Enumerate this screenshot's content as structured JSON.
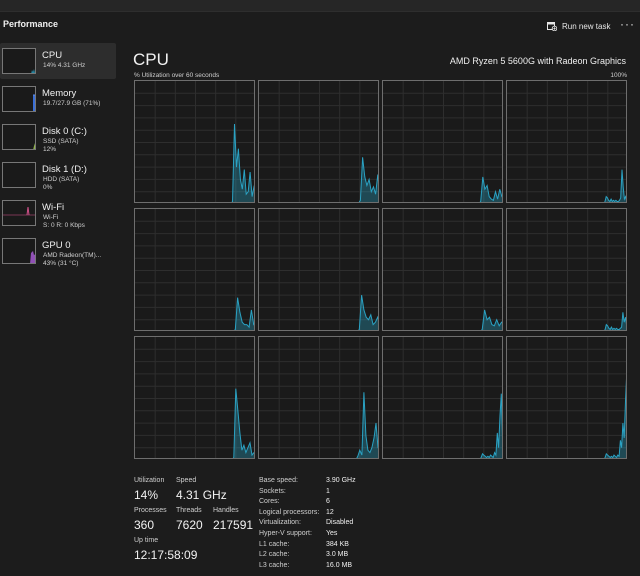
{
  "app": {
    "title": "Performance"
  },
  "toolbar": {
    "run_new_task": "Run new task",
    "more": "···"
  },
  "sidebar": {
    "items": [
      {
        "name": "CPU",
        "lines": [
          "14% 4.31 GHz"
        ],
        "color": "#2aa2c3",
        "level": 0.14
      },
      {
        "name": "Memory",
        "lines": [
          "19.7/27.9 GB (71%)"
        ],
        "color": "#3a6fd8",
        "level": 0.71
      },
      {
        "name": "Disk 0 (C:)",
        "lines": [
          "SSD (SATA)",
          "12%"
        ],
        "color": "#8fb34a",
        "level": 0.12
      },
      {
        "name": "Disk 1 (D:)",
        "lines": [
          "HDD (SATA)",
          "0%"
        ],
        "color": "#8fb34a",
        "level": 0.0
      },
      {
        "name": "Wi-Fi",
        "lines": [
          "Wi-Fi",
          "S: 0 R: 0 Kbps"
        ],
        "color": "#d0508a",
        "level": 0.0
      },
      {
        "name": "GPU 0",
        "lines": [
          "AMD Radeon(TM)...",
          "43% (31 °C)"
        ],
        "color": "#a65bd1",
        "level": 0.43
      }
    ]
  },
  "main": {
    "title": "CPU",
    "model": "AMD Ryzen 5 5600G with Radeon Graphics",
    "util_label": "% Utilization over 60 seconds",
    "util_max": "100%"
  },
  "chart_data": {
    "type": "area",
    "title": "% Utilization over 60 seconds",
    "ylim": [
      0,
      100
    ],
    "grid": true,
    "color": "#2aa2c3",
    "series": [
      {
        "values": [
          0,
          0,
          0,
          0,
          0,
          0,
          0,
          0,
          0,
          0,
          0,
          0,
          0,
          0,
          0,
          0,
          0,
          0,
          0,
          0,
          0,
          0,
          0,
          0,
          0,
          0,
          0,
          0,
          0,
          0,
          0,
          0,
          0,
          0,
          0,
          0,
          0,
          0,
          0,
          0,
          0,
          0,
          0,
          0,
          0,
          0,
          0,
          0,
          0,
          0,
          0,
          0,
          0,
          0,
          0,
          0,
          0,
          0,
          0,
          0,
          0,
          0,
          0,
          0,
          0,
          0,
          0,
          0,
          0,
          0,
          0,
          0,
          0,
          0,
          0,
          0,
          0,
          0,
          0,
          0,
          0,
          0,
          0,
          0,
          0,
          0,
          0,
          0,
          0,
          0,
          0,
          0,
          0,
          0,
          0,
          0,
          0,
          0,
          0,
          0,
          0,
          0,
          0,
          0,
          0,
          0,
          0,
          0,
          0,
          0,
          0,
          0,
          0,
          0,
          0,
          0,
          0,
          0,
          0,
          0
        ]
      },
      {
        "values": [
          0
        ]
      }
    ],
    "cores": [
      [
        0,
        0,
        0,
        0,
        0,
        0,
        0,
        0,
        0,
        0,
        0,
        0,
        0,
        0,
        0,
        0,
        0,
        0,
        0,
        0,
        0,
        0,
        0,
        0,
        0,
        0,
        0,
        0,
        0,
        0,
        0,
        0,
        0,
        0,
        0,
        0,
        0,
        0,
        0,
        0,
        0,
        0,
        0,
        0,
        0,
        0,
        0,
        0,
        0,
        0,
        0,
        0,
        0,
        0,
        0,
        0,
        0,
        0,
        0,
        0,
        0,
        0,
        0,
        0,
        0,
        0,
        0,
        0,
        0,
        0,
        0,
        0,
        0,
        0,
        0,
        0,
        0,
        0,
        0,
        0,
        0,
        0,
        0,
        0,
        0,
        0,
        0,
        0,
        0,
        0,
        0,
        0,
        0,
        0,
        0,
        0,
        0,
        0,
        0,
        0,
        0,
        0,
        0,
        0,
        0,
        0,
        0,
        0,
        0,
        0,
        0,
        0,
        0,
        0,
        0,
        0,
        0,
        0,
        0,
        0,
        0
      ]
    ]
  },
  "cores_chart": [
    [
      0,
      0,
      0,
      0,
      0,
      0,
      0,
      0,
      0,
      0,
      0,
      0,
      0,
      0,
      0,
      0,
      0,
      0,
      0,
      0,
      0,
      0,
      0,
      0,
      0,
      0,
      0,
      0,
      0,
      0,
      0,
      0,
      0,
      0,
      0,
      0,
      0,
      0,
      0,
      0,
      0,
      0,
      0,
      0,
      0,
      0,
      0,
      0,
      0,
      0,
      0,
      0,
      0,
      0,
      0,
      0,
      0,
      0,
      0,
      0,
      0,
      0,
      0,
      0,
      0,
      0,
      0,
      0,
      0,
      0,
      0,
      0,
      0,
      0,
      0,
      0,
      0,
      0,
      0,
      0,
      0,
      0,
      0,
      0,
      0,
      0,
      0,
      0,
      0,
      0,
      0,
      0,
      0,
      0,
      0,
      0,
      0,
      0,
      0,
      0,
      0,
      0,
      0,
      0,
      0,
      0,
      0,
      0,
      0,
      0,
      0,
      0,
      0,
      0,
      0,
      0,
      0,
      0,
      0,
      0
    ]
  ],
  "stats": {
    "utilization": {
      "label": "Utilization",
      "value": "14%"
    },
    "speed": {
      "label": "Speed",
      "value": "4.31 GHz"
    },
    "processes": {
      "label": "Processes",
      "value": "360"
    },
    "threads": {
      "label": "Threads",
      "value": "7620"
    },
    "handles": {
      "label": "Handles",
      "value": "217591"
    },
    "uptime": {
      "label": "Up time",
      "value": "12:17:58:09"
    }
  },
  "details": [
    {
      "key": "Base speed:",
      "value": "3.90 GHz"
    },
    {
      "key": "Sockets:",
      "value": "1"
    },
    {
      "key": "Cores:",
      "value": "6"
    },
    {
      "key": "Logical processors:",
      "value": "12"
    },
    {
      "key": "Virtualization:",
      "value": "Disabled"
    },
    {
      "key": "Hyper-V support:",
      "value": "Yes"
    },
    {
      "key": "L1 cache:",
      "value": "384 KB"
    },
    {
      "key": "L2 cache:",
      "value": "3.0 MB"
    },
    {
      "key": "L3 cache:",
      "value": "16.0 MB"
    }
  ]
}
